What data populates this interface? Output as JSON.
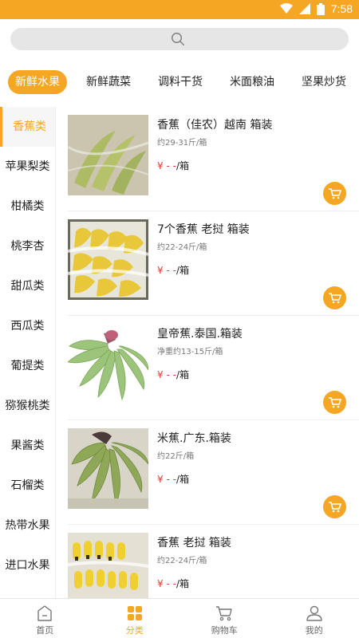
{
  "status_bar": {
    "time": "7:58"
  },
  "search": {
    "placeholder": ""
  },
  "category_tabs": [
    {
      "label": "新鲜水果",
      "active": true
    },
    {
      "label": "新鲜蔬菜",
      "active": false
    },
    {
      "label": "调料干货",
      "active": false
    },
    {
      "label": "米面粮油",
      "active": false
    },
    {
      "label": "坚果炒货",
      "active": false
    }
  ],
  "sidebar": {
    "items": [
      {
        "label": "香蕉类",
        "active": true
      },
      {
        "label": "苹果梨类",
        "active": false
      },
      {
        "label": "柑橘类",
        "active": false
      },
      {
        "label": "桃李杏",
        "active": false
      },
      {
        "label": "甜瓜类",
        "active": false
      },
      {
        "label": "西瓜类",
        "active": false
      },
      {
        "label": "葡提类",
        "active": false
      },
      {
        "label": "猕猴桃类",
        "active": false
      },
      {
        "label": "果酱类",
        "active": false
      },
      {
        "label": "石榴类",
        "active": false
      },
      {
        "label": "热带水果",
        "active": false
      },
      {
        "label": "进口水果",
        "active": false
      }
    ]
  },
  "products": [
    {
      "name": "香蕉（佳农）越南 箱装",
      "spec": "约29-31斤/箱",
      "currency": "¥ - -",
      "unit": "/箱",
      "image": "banana-bag"
    },
    {
      "name": "7个香蕉 老挝 箱装",
      "spec": "约22-24斤/箱",
      "currency": "¥ - -",
      "unit": "/箱",
      "image": "banana-box"
    },
    {
      "name": "皇帝蕉.泰国.箱装",
      "spec": "净重约13-15斤/箱",
      "currency": "¥ - -",
      "unit": "/箱",
      "image": "emperor-banana"
    },
    {
      "name": "米蕉.广东.箱装",
      "spec": "约22斤/箱",
      "currency": "¥ - -",
      "unit": "/箱",
      "image": "rice-banana"
    },
    {
      "name": "香蕉 老挝 箱装",
      "spec": "约22-24斤/箱",
      "currency": "¥ - -",
      "unit": "/箱",
      "image": "banana-yellow"
    }
  ],
  "bottom_nav": [
    {
      "label": "首页",
      "icon": "home-icon",
      "active": false
    },
    {
      "label": "分类",
      "icon": "category-icon",
      "active": true
    },
    {
      "label": "购物车",
      "icon": "cart-icon",
      "active": false
    },
    {
      "label": "我的",
      "icon": "user-icon",
      "active": false
    }
  ],
  "colors": {
    "accent": "#f5a623",
    "price": "#e53935"
  }
}
